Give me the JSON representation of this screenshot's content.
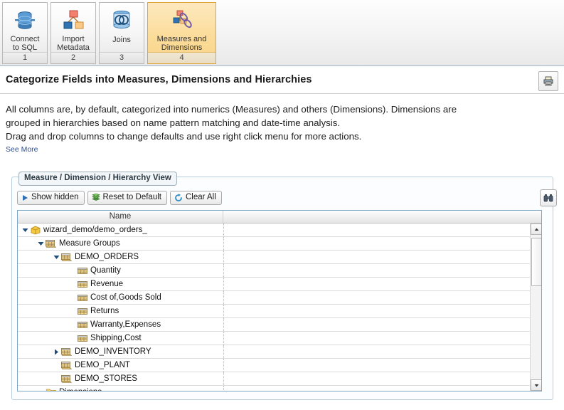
{
  "wizard": {
    "steps": [
      {
        "label": "Connect\nto SQL",
        "line1": "Connect",
        "line2": "to SQL",
        "number": "1",
        "icon": "database-icon",
        "active": false
      },
      {
        "label": "Import Metadata",
        "line1": "Import",
        "line2": "Metadata",
        "number": "2",
        "icon": "metadata-hierarchy-icon",
        "active": false
      },
      {
        "label": "Joins",
        "line1": "Joins",
        "line2": "",
        "number": "3",
        "icon": "joins-venn-icon",
        "active": false
      },
      {
        "label": "Measures and Dimensions",
        "line1": "Measures and",
        "line2": "Dimensions",
        "number": "4",
        "icon": "measures-dimensions-icon",
        "active": true
      }
    ]
  },
  "header": {
    "title": "Categorize Fields into Measures, Dimensions and Hierarchies",
    "print_icon": "printer-icon",
    "description_line1": "All columns are, by default, categorized into numerics (Measures) and others (Dimensions). Dimensions are",
    "description_line2": "grouped in hierarchies based on name pattern matching and date-time analysis.",
    "description_line3": "Drag and drop columns to change defaults and use right click menu for more actions.",
    "see_more": "See More"
  },
  "panel": {
    "tab_label": "Measure / Dimension / Hierarchy View",
    "buttons": [
      {
        "label": "Show hidden",
        "icon": "play-triangle-icon"
      },
      {
        "label": "Reset to Default",
        "icon": "green-stack-icon"
      },
      {
        "label": "Clear All",
        "icon": "refresh-circle-icon"
      }
    ],
    "find_icon": "binoculars-icon"
  },
  "grid": {
    "columns": [
      "Name"
    ],
    "rows": [
      {
        "label": "wizard_demo/demo_orders_",
        "depth": 0,
        "twisty": "expanded",
        "icon": "cube-icon"
      },
      {
        "label": "Measure Groups",
        "depth": 1,
        "twisty": "expanded",
        "icon": "measure-group-icon"
      },
      {
        "label": "DEMO_ORDERS",
        "depth": 2,
        "twisty": "expanded",
        "icon": "measure-group-icon"
      },
      {
        "label": "Quantity",
        "depth": 3,
        "twisty": "none",
        "icon": "measure-icon"
      },
      {
        "label": "Revenue",
        "depth": 3,
        "twisty": "none",
        "icon": "measure-icon"
      },
      {
        "label": "Cost of,Goods Sold",
        "depth": 3,
        "twisty": "none",
        "icon": "measure-icon"
      },
      {
        "label": "Returns",
        "depth": 3,
        "twisty": "none",
        "icon": "measure-icon"
      },
      {
        "label": "Warranty,Expenses",
        "depth": 3,
        "twisty": "none",
        "icon": "measure-icon"
      },
      {
        "label": "Shipping,Cost",
        "depth": 3,
        "twisty": "none",
        "icon": "measure-icon"
      },
      {
        "label": "DEMO_INVENTORY",
        "depth": 2,
        "twisty": "collapsed",
        "icon": "measure-group-icon"
      },
      {
        "label": "DEMO_PLANT",
        "depth": 2,
        "twisty": "none",
        "icon": "measure-group-icon"
      },
      {
        "label": "DEMO_STORES",
        "depth": 2,
        "twisty": "none",
        "icon": "measure-group-icon"
      },
      {
        "label": "Dimensions",
        "depth": 1,
        "twisty": "expanded",
        "icon": "folder-icon"
      }
    ]
  },
  "colors": {
    "accent_selected": "#f8d488",
    "panel_border": "#b8cddc",
    "grid_border": "#7da7c4",
    "link": "#2a4f8f"
  }
}
